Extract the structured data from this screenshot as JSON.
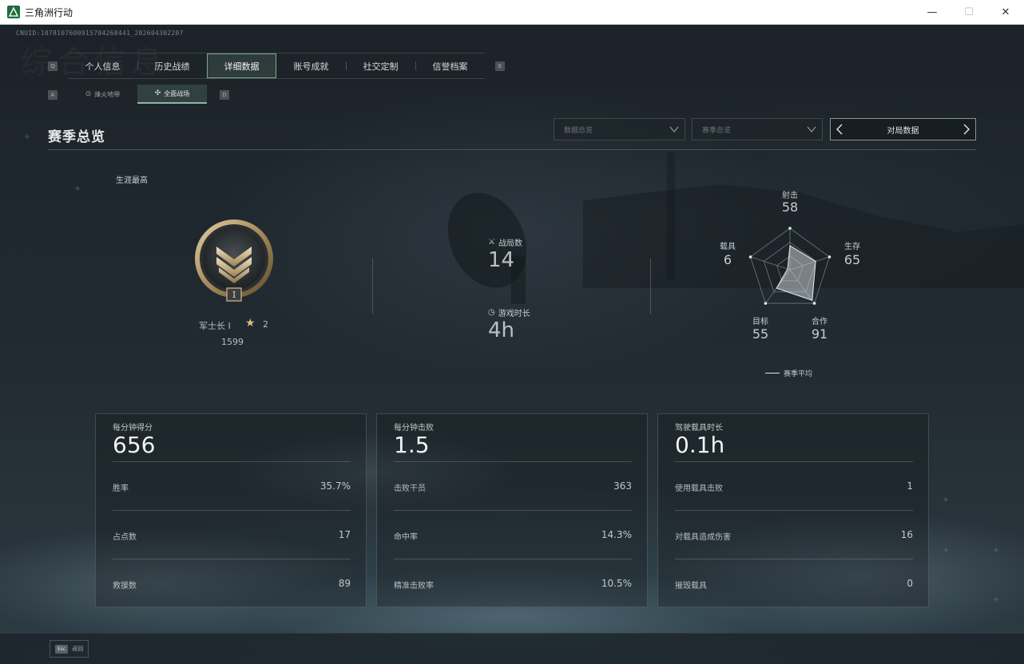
{
  "window": {
    "title": "三角洲行动",
    "minimize": "—",
    "maximize": "☐",
    "close": "✕"
  },
  "uid_text": "CNUID:1078107600915704268441_202604302207",
  "bg_title": "综合信息",
  "keyhints": {
    "prev_tab": "Q",
    "next_tab": "E",
    "prev_sub": "A",
    "next_sub": "D"
  },
  "tabs": [
    {
      "label": "个人信息"
    },
    {
      "label": "历史战绩"
    },
    {
      "label": "详细数据",
      "active": true
    },
    {
      "label": "账号成就"
    },
    {
      "label": "社交定制"
    },
    {
      "label": "信誉档案"
    }
  ],
  "subtabs": [
    {
      "label": "烽火地带",
      "icon": "target-icon"
    },
    {
      "label": "全面战场",
      "icon": "crosshair-icon",
      "active": true
    }
  ],
  "section": {
    "title": "赛季总览",
    "dropdown1": "数据总览",
    "dropdown2": "赛季总览",
    "pager_label": "对局数据"
  },
  "rank": {
    "career_label": "生涯最高",
    "name": "军士长 I",
    "stars": "2",
    "score": "1599",
    "badge_numeral": "I"
  },
  "summary": {
    "matches_label": "战局数",
    "matches_value": "14",
    "playtime_label": "游戏时长",
    "playtime_value": "4h"
  },
  "radar": {
    "axes": [
      {
        "label": "射击",
        "value": "58"
      },
      {
        "label": "生存",
        "value": "65"
      },
      {
        "label": "合作",
        "value": "91"
      },
      {
        "label": "目标",
        "value": "55"
      },
      {
        "label": "载具",
        "value": "6"
      }
    ],
    "legend": "赛季平均"
  },
  "cards": [
    {
      "head_label": "每分钟得分",
      "head_value": "656",
      "rows": [
        {
          "label": "胜率",
          "value": "35.7%"
        },
        {
          "label": "占点数",
          "value": "17"
        },
        {
          "label": "救援数",
          "value": "89"
        }
      ]
    },
    {
      "head_label": "每分钟击败",
      "head_value": "1.5",
      "rows": [
        {
          "label": "击败干员",
          "value": "363"
        },
        {
          "label": "命中率",
          "value": "14.3%"
        },
        {
          "label": "精准击败率",
          "value": "10.5%"
        }
      ]
    },
    {
      "head_label": "驾驶载具时长",
      "head_value": "0.1h",
      "rows": [
        {
          "label": "使用载具击败",
          "value": "1"
        },
        {
          "label": "对载具造成伤害",
          "value": "16"
        },
        {
          "label": "摧毁载具",
          "value": "0"
        }
      ]
    }
  ],
  "footer": {
    "esc_key": "Esc",
    "esc_label": "返回"
  },
  "colors": {
    "accent": "#7fa591",
    "background": "#1f272e",
    "text": "#c8ced2"
  }
}
